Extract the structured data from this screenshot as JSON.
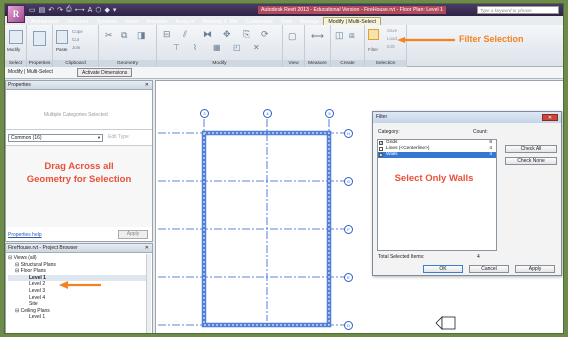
{
  "window": {
    "title": "Autodesk Revit 2013 - Educational Version -  FireHouse.rvt - Floor Plan: Level 1",
    "search_placeholder": "Type a keyword or phrase",
    "logo": "R"
  },
  "ribbon": {
    "tabs": [
      "Architecture",
      "Structure",
      "Systems",
      "Insert",
      "Annotate",
      "Analyze",
      "Massing & Site",
      "Collaborate",
      "View",
      "Manage",
      "Modify | Multi-Select"
    ],
    "active_tab": "Modify | Multi-Select",
    "panels": [
      "Select",
      "Properties",
      "Clipboard",
      "Geometry",
      "Modify",
      "View",
      "Measure",
      "Create",
      "Selection"
    ],
    "modify_label": "Modify",
    "paste_label": "Paste",
    "clipboard_items": [
      "Cope",
      "Cut",
      "Join"
    ],
    "selection_items": [
      "Filter",
      "Save",
      "Load",
      "Edit"
    ]
  },
  "options_bar": {
    "context": "Modify | Multi-Select",
    "button": "Activate Dimensions"
  },
  "properties": {
    "title": "Properties",
    "placeholder": "Multiple Categories Selected",
    "selector_value": "Common (16)",
    "edit_type": "Edit Type",
    "help_link": "Properties help",
    "apply": "Apply"
  },
  "project_browser": {
    "title": "FireHouse.rvt - Project Browser",
    "items": [
      {
        "label": "Views (all)",
        "indent": 0,
        "selected": false
      },
      {
        "label": "Structural Plans",
        "indent": 1,
        "selected": false
      },
      {
        "label": "Floor Plans",
        "indent": 1,
        "selected": false
      },
      {
        "label": "Level 1",
        "indent": 3,
        "selected": true
      },
      {
        "label": "Level 2",
        "indent": 3,
        "selected": false
      },
      {
        "label": "Level 3",
        "indent": 3,
        "selected": false
      },
      {
        "label": "Level 4",
        "indent": 3,
        "selected": false
      },
      {
        "label": "Site",
        "indent": 3,
        "selected": false
      },
      {
        "label": "Ceiling Plans",
        "indent": 1,
        "selected": false
      },
      {
        "label": "Level 1",
        "indent": 3,
        "selected": false
      }
    ]
  },
  "grid": {
    "vertical_labels": [
      "3",
      "4",
      "5"
    ],
    "horizontal_labels": [
      "H",
      "G",
      "F",
      "E",
      "D"
    ]
  },
  "filter_dialog": {
    "title": "Filter",
    "category_header": "Category:",
    "count_header": "Count:",
    "categories": [
      {
        "name": "Grids",
        "count": "8",
        "checked": true,
        "selected": false
      },
      {
        "name": "Lines (<Centerline>)",
        "count": "4",
        "checked": false,
        "selected": false
      },
      {
        "name": "Walls",
        "count": "4",
        "checked": true,
        "selected": true
      }
    ],
    "check_all": "Check All",
    "check_none": "Check None",
    "total_label": "Total Selected Items:",
    "total_value": "4",
    "ok": "OK",
    "cancel": "Cancel",
    "apply": "Apply"
  },
  "annotations": {
    "filter_selection": "Filter Selection",
    "drag_across": "Drag Across all Geometry for Selection",
    "select_walls": "Select Only Walls"
  },
  "colors": {
    "callout_orange": "#f58220",
    "callout_red": "#e8503a",
    "grid_blue": "#2b5fcf",
    "wall_selection": "#4f7fd8",
    "background_green": "#6e8b4a"
  }
}
